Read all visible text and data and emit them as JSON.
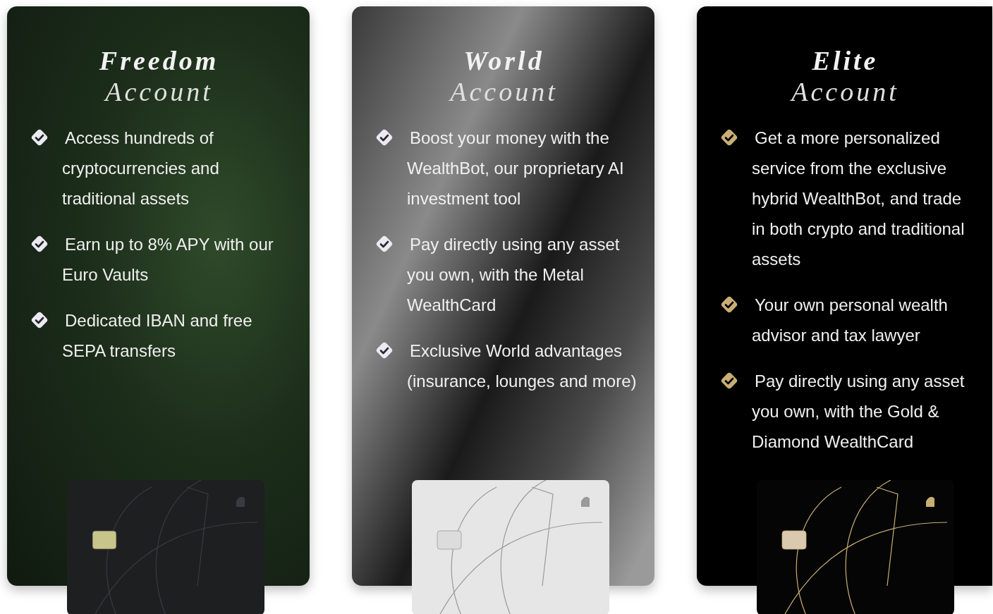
{
  "plans": [
    {
      "kind": "forest",
      "title": "Freedom",
      "subtitle": "Account",
      "features": [
        "Access hundreds of cryptocurrencies and traditional assets",
        "Earn up to 8% APY with our Euro Vaults",
        "Dedicated IBAN and free SEPA transfers"
      ],
      "card": {
        "kind": "black"
      }
    },
    {
      "kind": "metal",
      "title": "World",
      "subtitle": "Account",
      "features": [
        "Boost your money with the WealthBot, our proprietary AI investment tool",
        "Pay directly using any asset you own, with the Metal WealthCard",
        "Exclusive World advantages (insurance, lounges and more)"
      ],
      "card": {
        "kind": "silver"
      }
    },
    {
      "kind": "black",
      "title": "Elite",
      "subtitle": "Account",
      "features": [
        "Get a more personalized service from the exclusive hybrid WealthBot, and trade in both crypto and traditional assets",
        "Your own personal wealth advisor and tax lawyer",
        "Pay directly using any asset you own, with the Gold & Diamond WealthCard"
      ],
      "card": {
        "kind": "gold"
      }
    }
  ]
}
